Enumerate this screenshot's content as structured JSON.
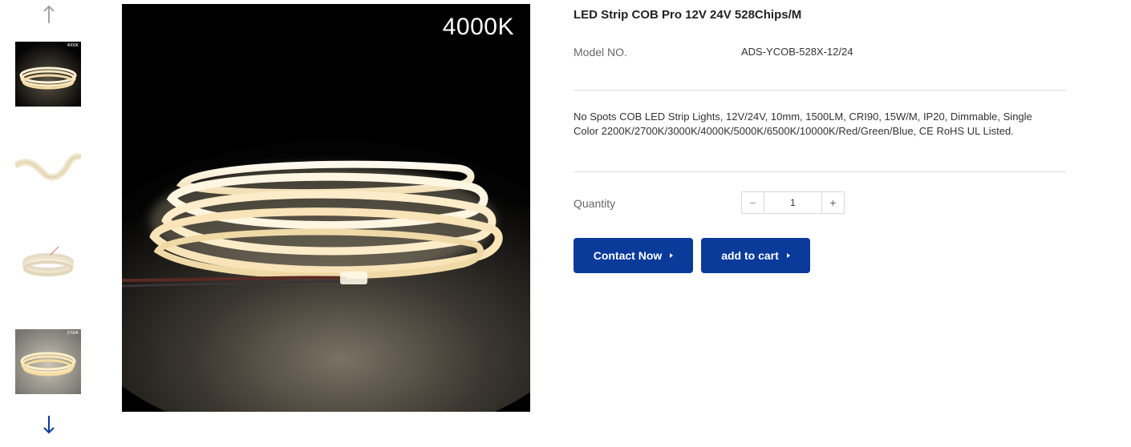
{
  "gallery": {
    "up_arrow_icon": "arrow-up-icon",
    "down_arrow_icon": "arrow-down-icon",
    "thumbnails": [
      {
        "label": "4000K"
      },
      {
        "label": ""
      },
      {
        "label": ""
      },
      {
        "label": "2700K"
      }
    ],
    "main_image": {
      "label": "4000K"
    }
  },
  "product": {
    "title": "LED Strip COB Pro 12V 24V 528Chips/M",
    "model_label": "Model NO.",
    "model_value": "ADS-YCOB-528X-12/24",
    "description": "No Spots COB LED Strip Lights, 12V/24V, 10mm, 1500LM, CRI90, 15W/M, IP20, Dimmable, Single Color 2200K/2700K/3000K/4000K/5000K/6500K/10000K/Red/Green/Blue, CE RoHS UL Listed.",
    "quantity_label": "Quantity",
    "quantity_value": "1",
    "minus_symbol": "−",
    "plus_symbol": "+",
    "contact_label": "Contact Now",
    "cart_label": "add to cart"
  },
  "colors": {
    "accent": "#0a3a9a",
    "down_arrow": "#0a3a9a",
    "up_arrow": "#999999"
  }
}
